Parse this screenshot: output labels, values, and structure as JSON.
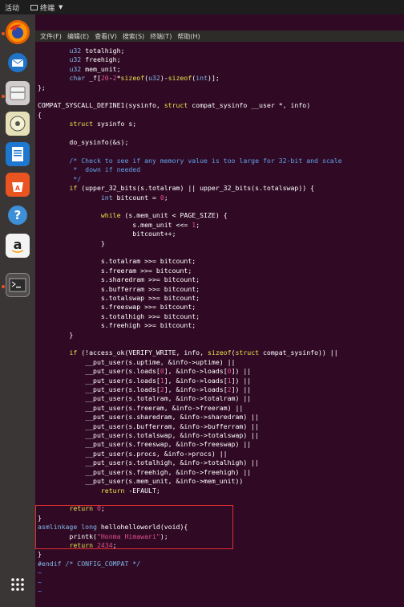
{
  "topbar": {
    "activities": "活动",
    "app_name": "终端"
  },
  "menubar": {
    "items": [
      "文件(F)",
      "编辑(E)",
      "查看(V)",
      "搜索(S)",
      "终端(T)",
      "帮助(H)"
    ]
  },
  "launcher": {
    "items": [
      {
        "name": "firefox-icon"
      },
      {
        "name": "thunderbird-icon"
      },
      {
        "name": "files-icon"
      },
      {
        "name": "rhythmbox-icon"
      },
      {
        "name": "libreoffice-writer-icon"
      },
      {
        "name": "software-center-icon"
      },
      {
        "name": "help-icon"
      },
      {
        "name": "amazon-icon"
      },
      {
        "name": "terminal-icon"
      }
    ],
    "show_apps_icon": "grid-icon"
  },
  "editor": {
    "lines": [
      "        u32 totalhigh;",
      "        u32 freehigh;",
      "        u32 mem_unit;",
      "        char _f[20-2*sizeof(u32)-sizeof(int)];",
      "};",
      "",
      "COMPAT_SYSCALL_DEFINE1(sysinfo, struct compat_sysinfo __user *, info)",
      "{",
      "        struct sysinfo s;",
      "",
      "        do_sysinfo(&s);",
      "",
      "        /* Check to see if any memory value is too large for 32-bit and scale",
      "         *  down if needed",
      "         */",
      "        if (upper_32_bits(s.totalram) || upper_32_bits(s.totalswap)) {",
      "                int bitcount = 0;",
      "",
      "                while (s.mem_unit < PAGE_SIZE) {",
      "                        s.mem_unit <<= 1;",
      "                        bitcount++;",
      "                }",
      "",
      "                s.totalram >>= bitcount;",
      "                s.freeram >>= bitcount;",
      "                s.sharedram >>= bitcount;",
      "                s.bufferram >>= bitcount;",
      "                s.totalswap >>= bitcount;",
      "                s.freeswap >>= bitcount;",
      "                s.totalhigh >>= bitcount;",
      "                s.freehigh >>= bitcount;",
      "        }",
      "",
      "        if (!access_ok(VERIFY_WRITE, info, sizeof(struct compat_sysinfo)) ||",
      "            __put_user(s.uptime, &info->uptime) ||",
      "            __put_user(s.loads[0], &info->loads[0]) ||",
      "            __put_user(s.loads[1], &info->loads[1]) ||",
      "            __put_user(s.loads[2], &info->loads[2]) ||",
      "            __put_user(s.totalram, &info->totalram) ||",
      "            __put_user(s.freeram, &info->freeram) ||",
      "            __put_user(s.sharedram, &info->sharedram) ||",
      "            __put_user(s.bufferram, &info->bufferram) ||",
      "            __put_user(s.totalswap, &info->totalswap) ||",
      "            __put_user(s.freeswap, &info->freeswap) ||",
      "            __put_user(s.procs, &info->procs) ||",
      "            __put_user(s.totalhigh, &info->totalhigh) ||",
      "            __put_user(s.freehigh, &info->freehigh) ||",
      "            __put_user(s.mem_unit, &info->mem_unit))",
      "                return -EFAULT;",
      "",
      "        return 0;",
      "}",
      "asmlinkage long hellohelloworld(void){",
      "        printk(\"Honma Himawari\");",
      "        return 2434;",
      "}",
      "#endif /* CONFIG_COMPAT */",
      "~",
      "~",
      "~"
    ]
  },
  "colors": {
    "terminal_bg": "#300a24",
    "keyword": "#e9e24c",
    "type": "#7fb6e8",
    "number": "#e0508a",
    "comment": "#5fa0e8",
    "highlight_box": "#e03030"
  }
}
